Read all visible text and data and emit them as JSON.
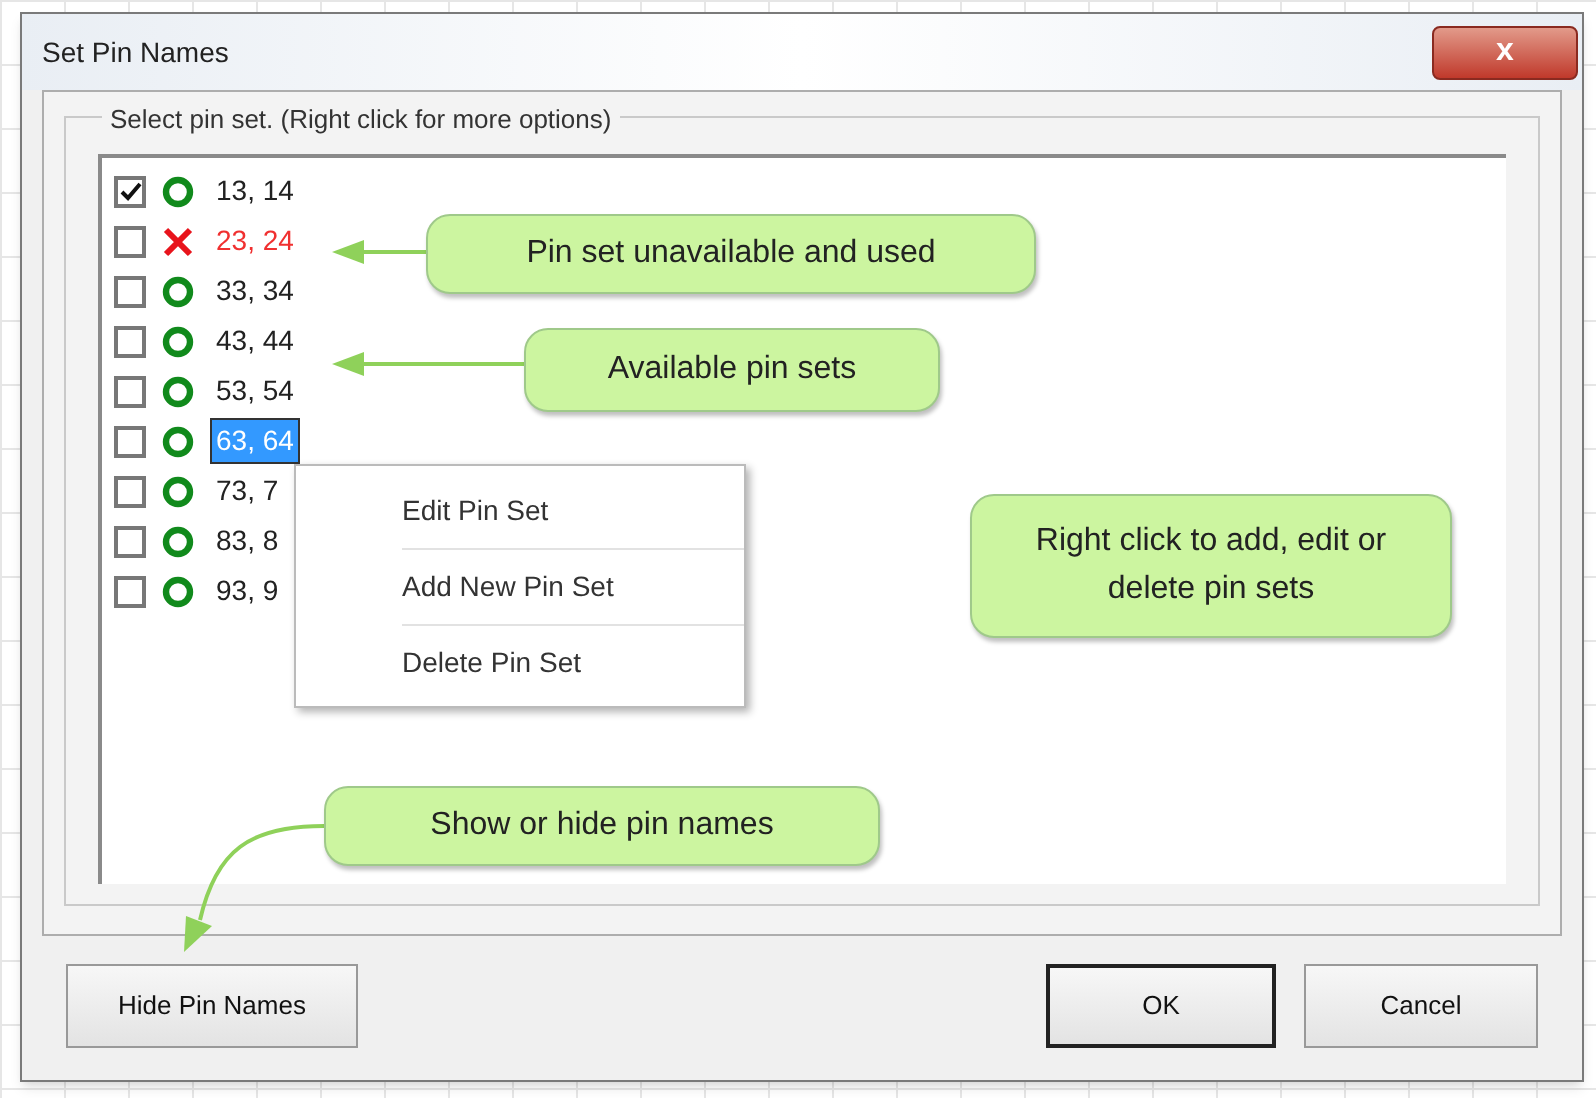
{
  "window": {
    "title": "Set Pin Names",
    "close": "x"
  },
  "group": {
    "label": "Select pin set. (Right click for more options)"
  },
  "pin_sets": [
    {
      "label": "13, 14",
      "checked": true,
      "used": false,
      "selected": false
    },
    {
      "label": "23, 24",
      "checked": false,
      "used": true,
      "selected": false
    },
    {
      "label": "33, 34",
      "checked": false,
      "used": false,
      "selected": false
    },
    {
      "label": "43, 44",
      "checked": false,
      "used": false,
      "selected": false
    },
    {
      "label": "53, 54",
      "checked": false,
      "used": false,
      "selected": false
    },
    {
      "label": "63, 64",
      "checked": false,
      "used": false,
      "selected": true
    },
    {
      "label": "73, 7",
      "checked": false,
      "used": false,
      "selected": false
    },
    {
      "label": "83, 8",
      "checked": false,
      "used": false,
      "selected": false
    },
    {
      "label": "93, 9",
      "checked": false,
      "used": false,
      "selected": false
    }
  ],
  "context_menu": [
    "Edit Pin Set",
    "Add New Pin Set",
    "Delete Pin Set"
  ],
  "callouts": [
    {
      "text": "Pin set unavailable and used",
      "kind": "left-arrow"
    },
    {
      "text": "Available pin sets",
      "kind": "left-arrow"
    },
    {
      "text": "Right click to add, edit or delete pin sets",
      "kind": "plain"
    },
    {
      "text": "Show or hide pin names",
      "kind": "curved-arrow"
    }
  ],
  "buttons": [
    {
      "label": "Hide Pin Names",
      "default": false
    },
    {
      "label": "OK",
      "default": true
    },
    {
      "label": "Cancel",
      "default": false
    }
  ]
}
